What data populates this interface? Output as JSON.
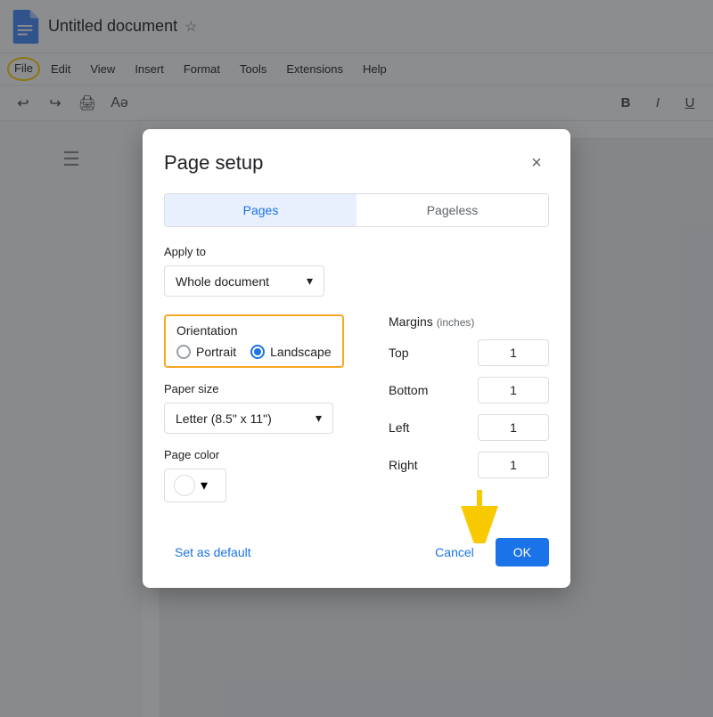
{
  "app": {
    "title": "Untitled document",
    "icon_color": "#4285f4"
  },
  "menubar": {
    "items": [
      "File",
      "Edit",
      "View",
      "Insert",
      "Format",
      "Tools",
      "Extensions",
      "Help"
    ]
  },
  "toolbar": {
    "undo": "↩",
    "redo": "↪",
    "print": "🖨",
    "bold": "B",
    "italic": "I",
    "underline": "U"
  },
  "dialog": {
    "title": "Page setup",
    "close_label": "×",
    "tabs": {
      "pages_label": "Pages",
      "pageless_label": "Pageless"
    },
    "apply_to": {
      "label": "Apply to",
      "value": "Whole document",
      "dropdown_icon": "▾"
    },
    "orientation": {
      "label": "Orientation",
      "portrait_label": "Portrait",
      "landscape_label": "Landscape",
      "selected": "landscape"
    },
    "paper_size": {
      "label": "Paper size",
      "value": "Letter (8.5\" x 11\")",
      "dropdown_icon": "▾"
    },
    "page_color": {
      "label": "Page color",
      "dropdown_icon": "▾"
    },
    "margins": {
      "title": "Margins",
      "unit": "(inches)",
      "top_label": "Top",
      "top_value": "1",
      "bottom_label": "Bottom",
      "bottom_value": "1",
      "left_label": "Left",
      "left_value": "1",
      "right_label": "Right",
      "right_value": "1"
    },
    "footer": {
      "set_default_label": "Set as default",
      "cancel_label": "Cancel",
      "ok_label": "OK"
    }
  }
}
